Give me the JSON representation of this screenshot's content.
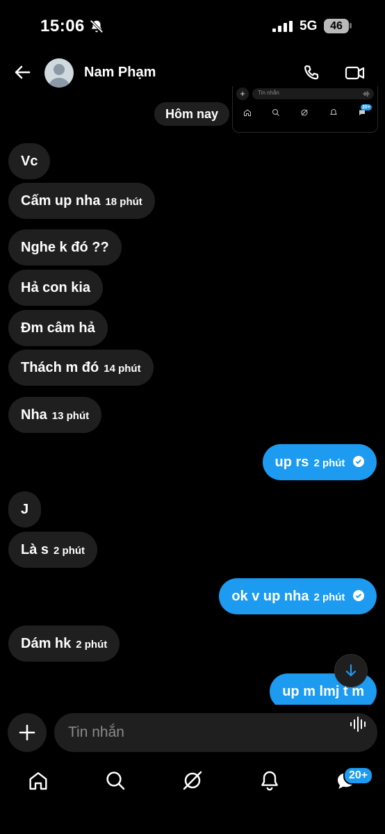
{
  "status_bar": {
    "time": "15:06",
    "network": "5G",
    "battery": "46"
  },
  "header": {
    "contact_name": "Nam Phạm"
  },
  "preview": {
    "input_placeholder": "Tin nhắn",
    "badge": "20+"
  },
  "date_separator": "Hôm nay",
  "messages": [
    {
      "text": "Vc",
      "time": ""
    },
    {
      "text": "Cấm up nha",
      "time": "18 phút"
    },
    {
      "text": "Nghe k đó ??",
      "time": ""
    },
    {
      "text": "Hả con kia",
      "time": ""
    },
    {
      "text": "Đm câm hả",
      "time": ""
    },
    {
      "text": "Thách m đó",
      "time": "14 phút"
    },
    {
      "text": "Nha",
      "time": "13 phút"
    },
    {
      "text": "up rs",
      "time": "2 phút"
    },
    {
      "text": "J",
      "time": ""
    },
    {
      "text": "Là s",
      "time": "2 phút"
    },
    {
      "text": "ok v up nha",
      "time": "2 phút"
    },
    {
      "text": "Dám hk",
      "time": "2 phút"
    },
    {
      "text": "up m lmj t m",
      "time": ""
    }
  ],
  "composer": {
    "placeholder": "Tin nhắn"
  },
  "bottom_nav": {
    "messages_badge": "20+"
  },
  "icons": {
    "back": "arrow-left-icon",
    "call": "phone-icon",
    "video": "video-camera-icon",
    "add": "plus-icon",
    "voice": "voice-waveform-icon",
    "home": "home-icon",
    "search": "search-icon",
    "grok": "grok-icon",
    "notifications": "bell-icon",
    "messages": "message-bubble-icon",
    "scroll": "arrow-down-icon",
    "sent": "check-circle-icon"
  },
  "colors": {
    "accent": "#1d9bf0",
    "bubble_incoming": "#1f1f1f",
    "background": "#000000"
  }
}
